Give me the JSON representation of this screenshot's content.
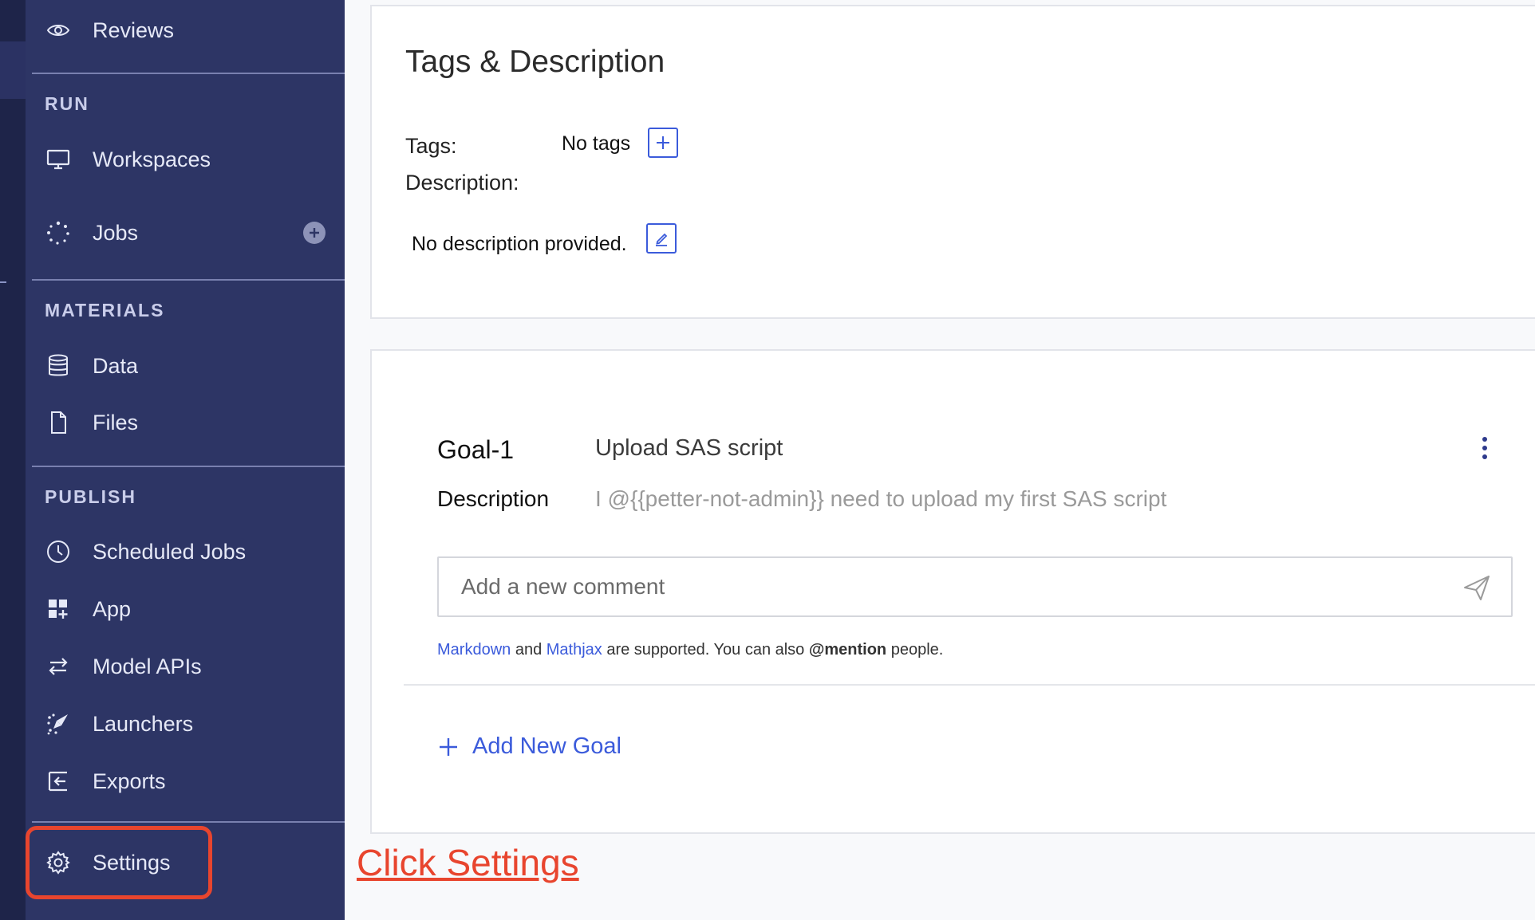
{
  "colors": {
    "sidebar_bg": "#2d3565",
    "accent_blue": "#3b5bdb",
    "annotation_red": "#e8452e"
  },
  "sidebar": {
    "reviews": {
      "label": "Reviews",
      "icon": "eye-icon"
    },
    "sections": {
      "run": "RUN",
      "materials": "MATERIALS",
      "publish": "PUBLISH"
    },
    "workspaces": {
      "label": "Workspaces",
      "icon": "monitor-icon"
    },
    "jobs": {
      "label": "Jobs",
      "icon": "spinner-icon"
    },
    "data": {
      "label": "Data",
      "icon": "database-icon"
    },
    "files": {
      "label": "Files",
      "icon": "file-icon"
    },
    "scheduled_jobs": {
      "label": "Scheduled Jobs",
      "icon": "clock-icon"
    },
    "app": {
      "label": "App",
      "icon": "app-grid-icon"
    },
    "model_apis": {
      "label": "Model APIs",
      "icon": "arrows-icon"
    },
    "launchers": {
      "label": "Launchers",
      "icon": "rocket-icon"
    },
    "exports": {
      "label": "Exports",
      "icon": "export-icon"
    },
    "settings": {
      "label": "Settings",
      "icon": "gear-icon"
    }
  },
  "annotation": {
    "text": "Click Settings"
  },
  "tags_card": {
    "title": "Tags & Description",
    "tags_label": "Tags:",
    "tags_value": "No tags",
    "description_label": "Description:",
    "description_value": "No description provided."
  },
  "goal": {
    "name": "Goal-1",
    "title": "Upload SAS script",
    "description_label": "Description",
    "description_text": "I @{{petter-not-admin}} need to upload my first SAS script",
    "comment_placeholder": "Add a new comment",
    "helper": {
      "markdown": "Markdown",
      "and": " and ",
      "mathjax": "Mathjax",
      "middle": " are supported. You can also ",
      "mention": "@mention",
      "end": " people."
    },
    "add_goal_label": "Add New Goal"
  }
}
